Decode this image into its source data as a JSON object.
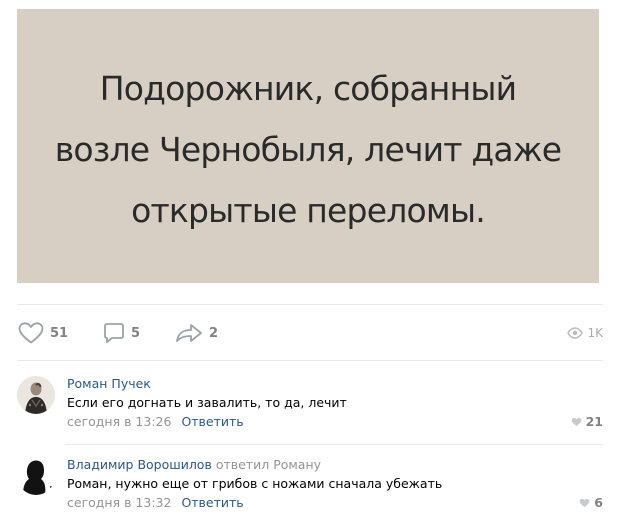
{
  "post": {
    "image_text_lines": [
      "Подорожник, собранный",
      "возле Чернобыля, лечит даже",
      "открытые переломы."
    ],
    "image_bg_color": "#d8cfc4",
    "actions": {
      "likes": "51",
      "comments": "5",
      "shares": "2",
      "views": "1K"
    }
  },
  "comments": [
    {
      "author": "Роман Пучек",
      "reply_to_prefix": "",
      "reply_to_name": "",
      "text": "Если его догнать и завалить, то да, лечит",
      "time": "сегодня в 13:26",
      "reply_label": "Ответить",
      "likes": "21",
      "avatar_icon": "user-avatar-photo"
    },
    {
      "author": "Владимир Ворошилов",
      "reply_to_prefix": "ответил",
      "reply_to_name": "Роману",
      "text": "Роман, нужно еще от грибов с ножами сначала убежать",
      "time": "сегодня в 13:32",
      "reply_label": "Ответить",
      "likes": "6",
      "avatar_icon": "user-avatar-silhouette"
    }
  ],
  "colors": {
    "link": "#2a5885",
    "muted": "#939393",
    "icon": "#99a2ad"
  }
}
